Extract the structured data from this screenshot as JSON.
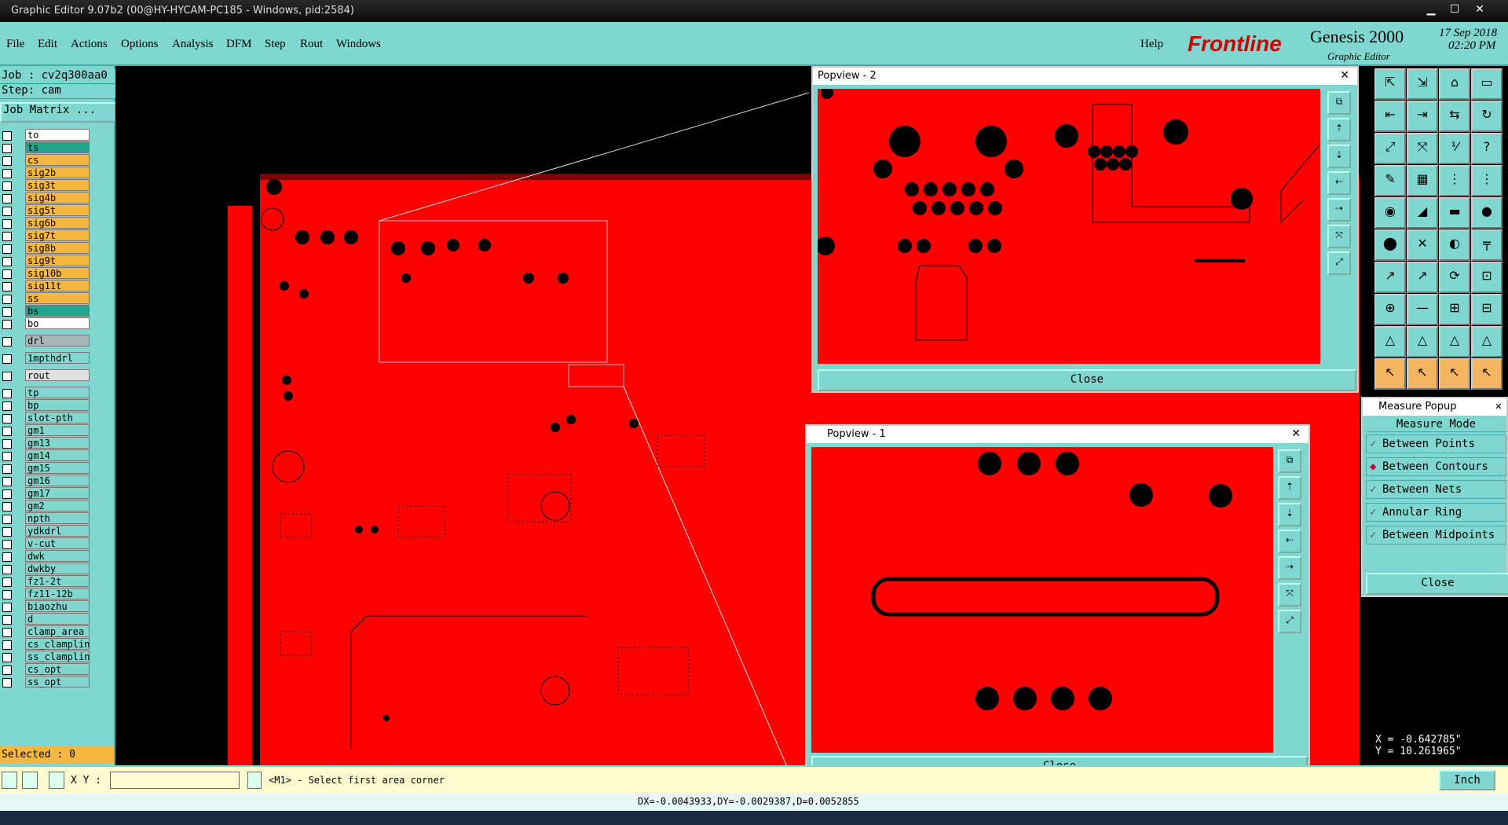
{
  "window": {
    "title": "Graphic Editor 9.07b2 (00@HY-HYCAM-PC185 - Windows, pid:2584)",
    "minimize": "▁",
    "maximize": "☐",
    "close": "✕"
  },
  "menubar": {
    "items": [
      "File",
      "Edit",
      "Actions",
      "Options",
      "Analysis",
      "DFM",
      "Step",
      "Rout",
      "Windows"
    ],
    "help": "Help"
  },
  "brand": {
    "logo": "Frontline",
    "product": "Genesis 2000",
    "subtitle": "Graphic Editor",
    "date": "17 Sep 2018",
    "time": "02:20 PM"
  },
  "job": {
    "job_label": "Job : cv2q300aa0",
    "step_label": "Step: cam",
    "matrix_button": "Job Matrix ..."
  },
  "layers": [
    {
      "name": "to",
      "bg": "#ffffff"
    },
    {
      "name": "ts",
      "bg": "#22a58c"
    },
    {
      "name": "cs",
      "bg": "#f5b740"
    },
    {
      "name": "sig2b",
      "bg": "#f5b740"
    },
    {
      "name": "sig3t",
      "bg": "#f5b740"
    },
    {
      "name": "sig4b",
      "bg": "#f5b740"
    },
    {
      "name": "sig5t",
      "bg": "#f5b740"
    },
    {
      "name": "sig6b",
      "bg": "#f5b740"
    },
    {
      "name": "sig7t",
      "bg": "#f5b740"
    },
    {
      "name": "sig8b",
      "bg": "#f5b740"
    },
    {
      "name": "sig9t",
      "bg": "#f5b740"
    },
    {
      "name": "sig10b",
      "bg": "#f5b740"
    },
    {
      "name": "sig11t",
      "bg": "#f5b740"
    },
    {
      "name": "ss",
      "bg": "#f5b740"
    },
    {
      "name": "bs",
      "bg": "#22a58c"
    },
    {
      "name": "bo",
      "bg": "#ffffff"
    },
    {
      "name": "drl",
      "bg": "#a8b8b8"
    },
    {
      "name": "1mpthdrl",
      "bg": "#7fd7d0"
    },
    {
      "name": "rout",
      "bg": "#e0e0e0"
    },
    {
      "name": "tp",
      "bg": "#7fd7d0"
    },
    {
      "name": "bp",
      "bg": "#7fd7d0"
    },
    {
      "name": "slot-pth",
      "bg": "#7fd7d0"
    },
    {
      "name": "gm1",
      "bg": "#7fd7d0"
    },
    {
      "name": "gm13",
      "bg": "#7fd7d0"
    },
    {
      "name": "gm14",
      "bg": "#7fd7d0"
    },
    {
      "name": "gm15",
      "bg": "#7fd7d0"
    },
    {
      "name": "gm16",
      "bg": "#7fd7d0"
    },
    {
      "name": "gm17",
      "bg": "#7fd7d0"
    },
    {
      "name": "gm2",
      "bg": "#7fd7d0"
    },
    {
      "name": "npth",
      "bg": "#7fd7d0"
    },
    {
      "name": "ydkdrl",
      "bg": "#7fd7d0"
    },
    {
      "name": "v-cut",
      "bg": "#7fd7d0"
    },
    {
      "name": "dwk",
      "bg": "#7fd7d0"
    },
    {
      "name": "dwkby",
      "bg": "#7fd7d0"
    },
    {
      "name": "fz1-2t",
      "bg": "#7fd7d0"
    },
    {
      "name": "fz11-12b",
      "bg": "#7fd7d0"
    },
    {
      "name": "biaozhu",
      "bg": "#7fd7d0"
    },
    {
      "name": "d",
      "bg": "#7fd7d0"
    },
    {
      "name": "clamp_area",
      "bg": "#7fd7d0"
    },
    {
      "name": "cs_clamplin",
      "bg": "#7fd7d0"
    },
    {
      "name": "ss_clamplin",
      "bg": "#7fd7d0"
    },
    {
      "name": "cs_opt",
      "bg": "#7fd7d0"
    },
    {
      "name": "ss_opt",
      "bg": "#7fd7d0"
    }
  ],
  "selected_label": "Selected : 0",
  "popview2": {
    "title": "Popview - 2",
    "close": "Close"
  },
  "popview1": {
    "title": "Popview - 1",
    "close": "Close"
  },
  "measure": {
    "title": "Measure Popup",
    "mode_header": "Measure Mode",
    "options": [
      "Between Points",
      "Between Contours",
      "Between Nets",
      "Annular Ring",
      "Between Midpoints"
    ],
    "active_option": "Between Contours",
    "close": "Close"
  },
  "coords": {
    "x": "X = -0.642785\"",
    "y": "Y = 10.261965\""
  },
  "status": {
    "xy_label": "X Y :",
    "xy_value": "",
    "prompt": "<M1> - Select first area corner",
    "units": "Inch"
  },
  "measurement": "DX=-0.0043933,DY=-0.0029387,D=0.0052855",
  "colors": {
    "accent": "#7fd7d0",
    "board": "#ff0000",
    "highlight": "#f5b740"
  }
}
